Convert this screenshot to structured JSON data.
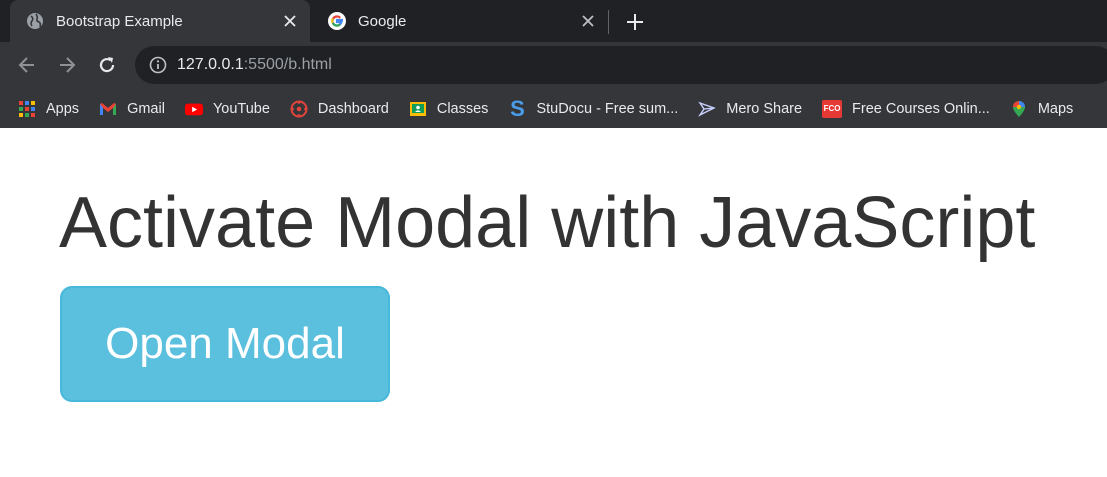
{
  "tabs": [
    {
      "title": "Bootstrap Example",
      "icon": "globe-icon",
      "active": true
    },
    {
      "title": "Google",
      "icon": "google-icon",
      "active": false
    }
  ],
  "address_bar": {
    "host": "127.0.0.1",
    "rest": ":5500/b.html"
  },
  "bookmarks": [
    {
      "label": "Apps",
      "icon": "apps-grid-icon"
    },
    {
      "label": "Gmail",
      "icon": "gmail-icon"
    },
    {
      "label": "YouTube",
      "icon": "youtube-icon"
    },
    {
      "label": "Dashboard",
      "icon": "dashboard-icon"
    },
    {
      "label": "Classes",
      "icon": "google-classroom-icon"
    },
    {
      "label": "StuDocu - Free sum...",
      "icon": "studocu-icon"
    },
    {
      "label": "Mero Share",
      "icon": "mero-share-icon"
    },
    {
      "label": "Free Courses Onlin...",
      "icon": "fco-icon",
      "icon_text": "FCO"
    },
    {
      "label": "Maps",
      "icon": "maps-pin-icon"
    }
  ],
  "page": {
    "heading": "Activate Modal with JavaScript",
    "button_label": "Open Modal"
  },
  "colors": {
    "chrome_dark": "#202124",
    "chrome_toolbar": "#35363a",
    "button_info": "#5bc0de",
    "button_border": "#46b8da",
    "heading_text": "#333333"
  }
}
